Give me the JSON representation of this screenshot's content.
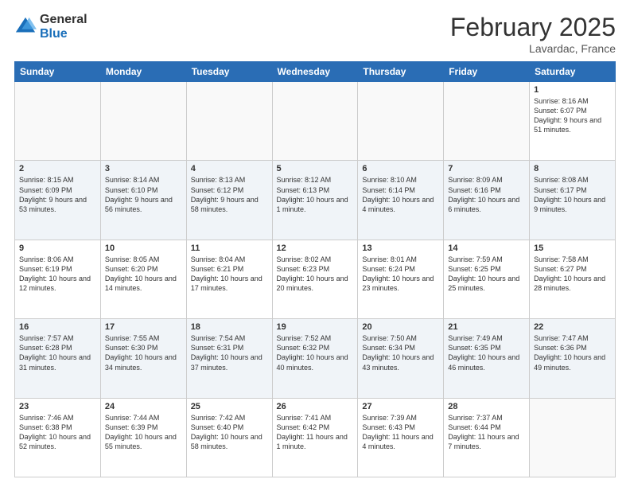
{
  "logo": {
    "general": "General",
    "blue": "Blue"
  },
  "title": "February 2025",
  "location": "Lavardac, France",
  "days_header": [
    "Sunday",
    "Monday",
    "Tuesday",
    "Wednesday",
    "Thursday",
    "Friday",
    "Saturday"
  ],
  "weeks": [
    [
      {
        "day": "",
        "detail": ""
      },
      {
        "day": "",
        "detail": ""
      },
      {
        "day": "",
        "detail": ""
      },
      {
        "day": "",
        "detail": ""
      },
      {
        "day": "",
        "detail": ""
      },
      {
        "day": "",
        "detail": ""
      },
      {
        "day": "1",
        "detail": "Sunrise: 8:16 AM\nSunset: 6:07 PM\nDaylight: 9 hours and 51 minutes."
      }
    ],
    [
      {
        "day": "2",
        "detail": "Sunrise: 8:15 AM\nSunset: 6:09 PM\nDaylight: 9 hours and 53 minutes."
      },
      {
        "day": "3",
        "detail": "Sunrise: 8:14 AM\nSunset: 6:10 PM\nDaylight: 9 hours and 56 minutes."
      },
      {
        "day": "4",
        "detail": "Sunrise: 8:13 AM\nSunset: 6:12 PM\nDaylight: 9 hours and 58 minutes."
      },
      {
        "day": "5",
        "detail": "Sunrise: 8:12 AM\nSunset: 6:13 PM\nDaylight: 10 hours and 1 minute."
      },
      {
        "day": "6",
        "detail": "Sunrise: 8:10 AM\nSunset: 6:14 PM\nDaylight: 10 hours and 4 minutes."
      },
      {
        "day": "7",
        "detail": "Sunrise: 8:09 AM\nSunset: 6:16 PM\nDaylight: 10 hours and 6 minutes."
      },
      {
        "day": "8",
        "detail": "Sunrise: 8:08 AM\nSunset: 6:17 PM\nDaylight: 10 hours and 9 minutes."
      }
    ],
    [
      {
        "day": "9",
        "detail": "Sunrise: 8:06 AM\nSunset: 6:19 PM\nDaylight: 10 hours and 12 minutes."
      },
      {
        "day": "10",
        "detail": "Sunrise: 8:05 AM\nSunset: 6:20 PM\nDaylight: 10 hours and 14 minutes."
      },
      {
        "day": "11",
        "detail": "Sunrise: 8:04 AM\nSunset: 6:21 PM\nDaylight: 10 hours and 17 minutes."
      },
      {
        "day": "12",
        "detail": "Sunrise: 8:02 AM\nSunset: 6:23 PM\nDaylight: 10 hours and 20 minutes."
      },
      {
        "day": "13",
        "detail": "Sunrise: 8:01 AM\nSunset: 6:24 PM\nDaylight: 10 hours and 23 minutes."
      },
      {
        "day": "14",
        "detail": "Sunrise: 7:59 AM\nSunset: 6:25 PM\nDaylight: 10 hours and 25 minutes."
      },
      {
        "day": "15",
        "detail": "Sunrise: 7:58 AM\nSunset: 6:27 PM\nDaylight: 10 hours and 28 minutes."
      }
    ],
    [
      {
        "day": "16",
        "detail": "Sunrise: 7:57 AM\nSunset: 6:28 PM\nDaylight: 10 hours and 31 minutes."
      },
      {
        "day": "17",
        "detail": "Sunrise: 7:55 AM\nSunset: 6:30 PM\nDaylight: 10 hours and 34 minutes."
      },
      {
        "day": "18",
        "detail": "Sunrise: 7:54 AM\nSunset: 6:31 PM\nDaylight: 10 hours and 37 minutes."
      },
      {
        "day": "19",
        "detail": "Sunrise: 7:52 AM\nSunset: 6:32 PM\nDaylight: 10 hours and 40 minutes."
      },
      {
        "day": "20",
        "detail": "Sunrise: 7:50 AM\nSunset: 6:34 PM\nDaylight: 10 hours and 43 minutes."
      },
      {
        "day": "21",
        "detail": "Sunrise: 7:49 AM\nSunset: 6:35 PM\nDaylight: 10 hours and 46 minutes."
      },
      {
        "day": "22",
        "detail": "Sunrise: 7:47 AM\nSunset: 6:36 PM\nDaylight: 10 hours and 49 minutes."
      }
    ],
    [
      {
        "day": "23",
        "detail": "Sunrise: 7:46 AM\nSunset: 6:38 PM\nDaylight: 10 hours and 52 minutes."
      },
      {
        "day": "24",
        "detail": "Sunrise: 7:44 AM\nSunset: 6:39 PM\nDaylight: 10 hours and 55 minutes."
      },
      {
        "day": "25",
        "detail": "Sunrise: 7:42 AM\nSunset: 6:40 PM\nDaylight: 10 hours and 58 minutes."
      },
      {
        "day": "26",
        "detail": "Sunrise: 7:41 AM\nSunset: 6:42 PM\nDaylight: 11 hours and 1 minute."
      },
      {
        "day": "27",
        "detail": "Sunrise: 7:39 AM\nSunset: 6:43 PM\nDaylight: 11 hours and 4 minutes."
      },
      {
        "day": "28",
        "detail": "Sunrise: 7:37 AM\nSunset: 6:44 PM\nDaylight: 11 hours and 7 minutes."
      },
      {
        "day": "",
        "detail": ""
      }
    ]
  ]
}
